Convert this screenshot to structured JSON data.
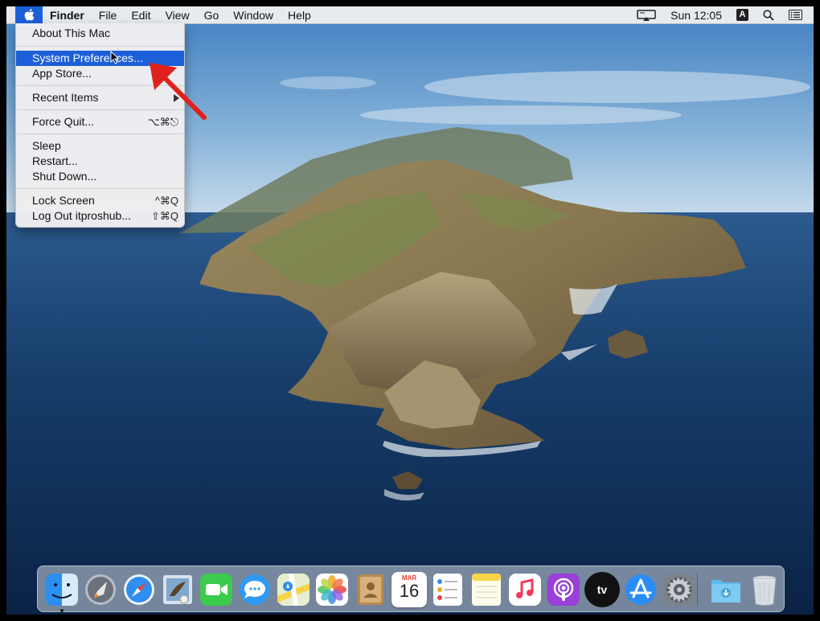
{
  "menubar": {
    "app_name": "Finder",
    "menus": [
      "File",
      "Edit",
      "View",
      "Go",
      "Window",
      "Help"
    ],
    "clock": "Sun 12:05",
    "input_source": "A"
  },
  "apple_menu": {
    "items": [
      {
        "label": "About This Mac",
        "shortcut": ""
      },
      {
        "label": "System Preferences...",
        "shortcut": ""
      },
      {
        "label": "App Store...",
        "shortcut": ""
      },
      {
        "label": "Recent Items",
        "shortcut": ""
      },
      {
        "label": "Force Quit...",
        "shortcut": "⌥⌘⎋"
      },
      {
        "label": "Sleep",
        "shortcut": ""
      },
      {
        "label": "Restart...",
        "shortcut": ""
      },
      {
        "label": "Shut Down...",
        "shortcut": ""
      },
      {
        "label": "Lock Screen",
        "shortcut": "^⌘Q"
      },
      {
        "label": "Log Out itproshub...",
        "shortcut": "⇧⌘Q"
      }
    ],
    "highlighted_item": "System Preferences..."
  },
  "dock": {
    "apps": [
      "finder-icon",
      "launchpad-icon",
      "safari-icon",
      "mail-icon",
      "facetime-icon",
      "messages-icon",
      "maps-icon",
      "photos-icon",
      "contacts-icon",
      "calendar-icon",
      "reminders-icon",
      "notes-icon",
      "music-icon",
      "podcasts-icon",
      "tv-icon",
      "app-store-icon",
      "system-preferences-icon",
      "downloads-folder-icon",
      "trash-icon"
    ],
    "calendar_month": "MAR",
    "calendar_day": "16",
    "tv_label": "tv"
  },
  "colors": {
    "highlight": "#1c5fd8",
    "annotation_arrow": "#e0201a"
  }
}
